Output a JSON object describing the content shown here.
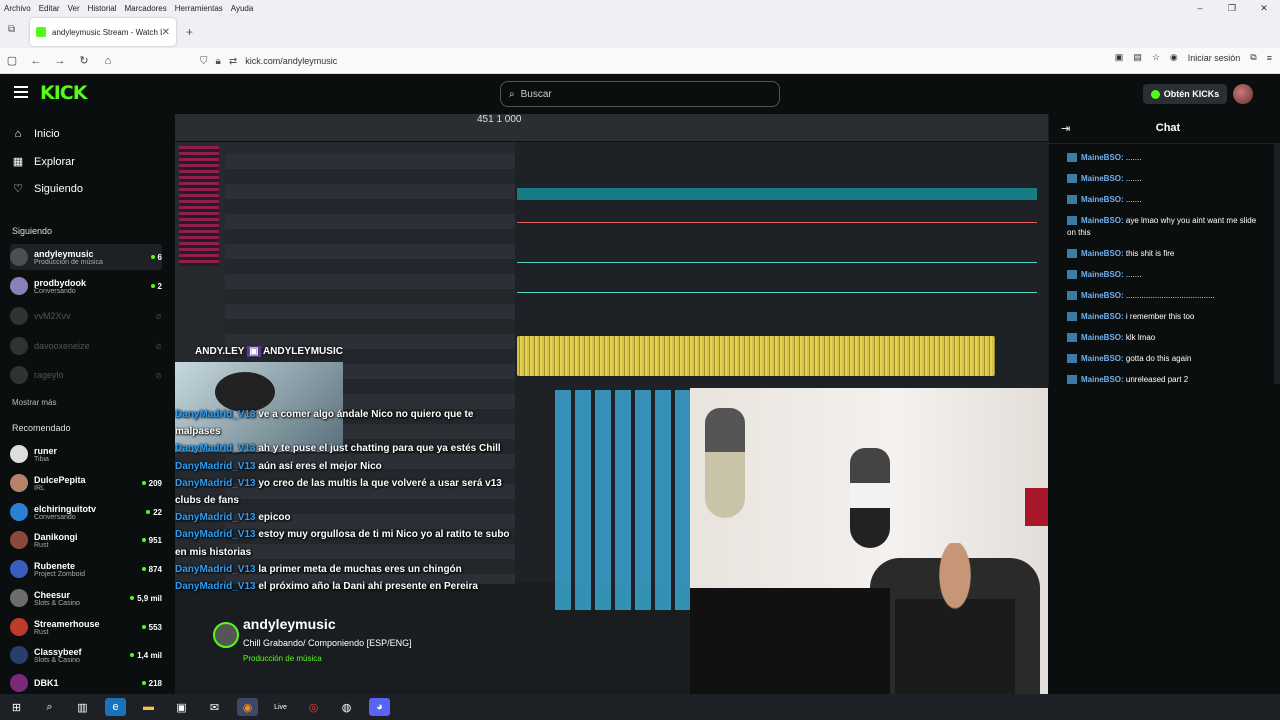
{
  "browser": {
    "menu": [
      "Archivo",
      "Editar",
      "Ver",
      "Historial",
      "Marcadores",
      "Herramientas",
      "Ayuda"
    ],
    "tab_title": "andyleymusic Stream - Watch L",
    "url": "kick.com/andyleymusic",
    "signin": "Iniciar sesión"
  },
  "header": {
    "logo": "KICK",
    "search_placeholder": "Buscar",
    "kicks_button": "Obtén KICKs"
  },
  "sidebar": {
    "nav": [
      {
        "label": "Inicio",
        "icon": "home-icon"
      },
      {
        "label": "Explorar",
        "icon": "explore-icon"
      },
      {
        "label": "Siguiendo",
        "icon": "heart-icon"
      }
    ],
    "following_title": "Siguiendo",
    "following": [
      {
        "name": "andyleymusic",
        "category": "Producción de música",
        "viewers": "6",
        "live": true
      },
      {
        "name": "prodbydook",
        "category": "Conversando",
        "viewers": "2",
        "live": true
      },
      {
        "name": "vvM2Xvv",
        "category": "",
        "viewers": "",
        "live": false
      },
      {
        "name": "davooxeneize",
        "category": "",
        "viewers": "",
        "live": false
      },
      {
        "name": "rageylo",
        "category": "",
        "viewers": "",
        "live": false
      }
    ],
    "show_more": "Mostrar más",
    "recommended_title": "Recomendado",
    "recommended": [
      {
        "name": "runer",
        "category": "Tibia",
        "viewers": ""
      },
      {
        "name": "DulcePepita",
        "category": "IRL",
        "viewers": "209"
      },
      {
        "name": "elchiringuitotv",
        "category": "Conversando",
        "viewers": "22"
      },
      {
        "name": "Danikongi",
        "category": "Rust",
        "viewers": "951"
      },
      {
        "name": "Rubenete",
        "category": "Project Zomboid",
        "viewers": "874"
      },
      {
        "name": "Cheesur",
        "category": "Slots & Casino",
        "viewers": "5,9 mil"
      },
      {
        "name": "Streamerhouse",
        "category": "Rust",
        "viewers": "553"
      },
      {
        "name": "Classybeef",
        "category": "Slots & Casino",
        "viewers": "1,4 mil"
      },
      {
        "name": "DBK1",
        "category": "",
        "viewers": "218"
      }
    ]
  },
  "player": {
    "daw_time": "451 1 000",
    "overlay_name": "ANDY.LEY",
    "overlay_handle": "ANDYLEYMUSIC",
    "streamer_name": "andyleymusic",
    "stream_title": "Chill Grabando/ Componiendo [ESP/ENG]",
    "stream_category": "Producción de música",
    "overlay_chat": [
      {
        "user": "DanyMadrid_V13",
        "text": "ve a comer algo ándale Nico no quiero que te malpases"
      },
      {
        "user": "DanyMadrid_V13",
        "text": "ah y te puse el just chatting para que ya estés Chill"
      },
      {
        "user": "DanyMadrid_V13",
        "text": "aún así eres el mejor Nico"
      },
      {
        "user": "DanyMadrid_V13",
        "text": "yo creo de las multis la que volveré a usar será v13 clubs de fans"
      },
      {
        "user": "DanyMadrid_V13",
        "text": "epicoo"
      },
      {
        "user": "DanyMadrid_V13",
        "text": "estoy muy orgullosa de ti mi Nico yo al ratito te subo en mis historias"
      },
      {
        "user": "DanyMadrid_V13",
        "text": "la primer meta de muchas eres un chingón"
      },
      {
        "user": "DanyMadrid_V13",
        "text": "el próximo año la Dani ahí presente en Pereira"
      }
    ]
  },
  "chat": {
    "title": "Chat",
    "messages": [
      {
        "user": "MaineBSO:",
        "text": "......."
      },
      {
        "user": "MaineBSO:",
        "text": "......."
      },
      {
        "user": "MaineBSO:",
        "text": "......."
      },
      {
        "user": "MaineBSO:",
        "text": "aye lmao why you aint want me slide on this"
      },
      {
        "user": "MaineBSO:",
        "text": "this shit is fire"
      },
      {
        "user": "MaineBSO:",
        "text": "......."
      },
      {
        "user": "MaineBSO:",
        "text": "........................................"
      },
      {
        "user": "MaineBSO:",
        "text": "i remember this too"
      },
      {
        "user": "MaineBSO:",
        "text": "klk lmao"
      },
      {
        "user": "MaineBSO:",
        "text": "gotta do this again"
      },
      {
        "user": "MaineBSO:",
        "text": "unreleased part 2"
      }
    ]
  },
  "taskbar": [
    "windows-icon",
    "search-icon",
    "task-view-icon",
    "edge-icon",
    "folder-icon",
    "store-icon",
    "mail-icon",
    "firefox-icon",
    "live-icon",
    "chrome-icon",
    "obs-icon",
    "discord-icon"
  ],
  "colors": {
    "brand": "#53fc18",
    "background": "#0b0e0f",
    "chat_user": "#6fb1f0"
  }
}
